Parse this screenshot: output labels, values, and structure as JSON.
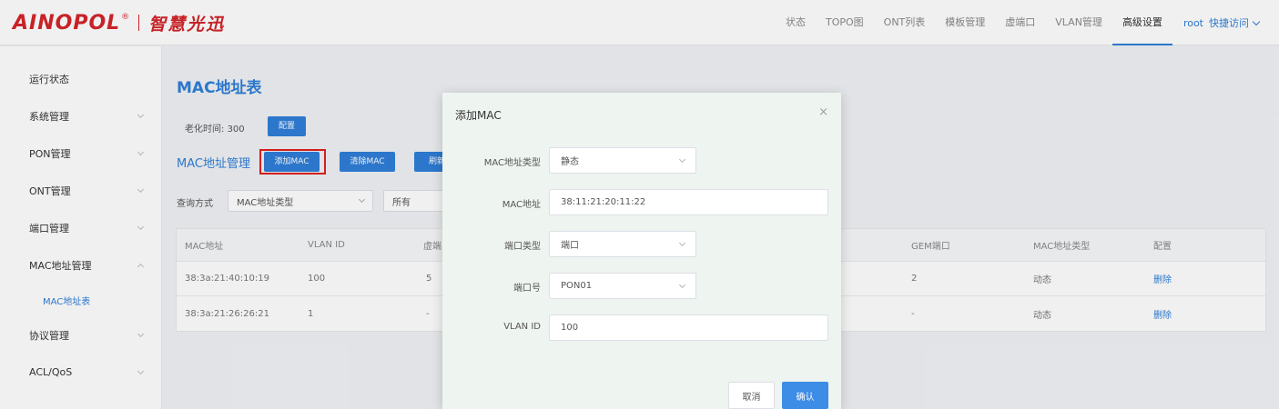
{
  "brand": {
    "name": "AINOPOL",
    "reg": "®",
    "cn": "智慧光迅"
  },
  "nav": {
    "items": [
      "状态",
      "TOPO图",
      "ONT列表",
      "模板管理",
      "虚端口",
      "VLAN管理",
      "高级设置"
    ],
    "active_index": 6,
    "user": "root",
    "quick": "快捷访问"
  },
  "sidebar": {
    "items": [
      {
        "label": "运行状态"
      },
      {
        "label": "系统管理"
      },
      {
        "label": "PON管理"
      },
      {
        "label": "ONT管理"
      },
      {
        "label": "端口管理"
      },
      {
        "label": "MAC地址管理",
        "expanded": true
      },
      {
        "label": "协议管理"
      },
      {
        "label": "ACL/QoS"
      }
    ],
    "sub_item": "MAC地址表"
  },
  "main": {
    "title": "MAC地址表",
    "aging_label": "老化时间:",
    "aging_value": "300",
    "config_button": "配置",
    "section_title": "MAC地址管理",
    "add_button": "添加MAC",
    "clear_button": "清除MAC",
    "refresh_button": "刷新",
    "query_label": "查询方式",
    "query_type": "MAC地址类型",
    "query_value": "所有"
  },
  "table": {
    "headers": [
      "MAC地址",
      "VLAN ID",
      "虚端",
      "GEM端口",
      "MAC地址类型",
      "配置"
    ],
    "rows": [
      [
        "38:3a:21:40:10:19",
        "100",
        "5",
        "2",
        "动态",
        "删除"
      ],
      [
        "38:3a:21:26:26:21",
        "1",
        "-",
        "-",
        "动态",
        "删除"
      ]
    ]
  },
  "modal": {
    "title": "添加MAC",
    "close": "×",
    "fields": {
      "mac_type_label": "MAC地址类型",
      "mac_type_value": "静态",
      "mac_addr_label": "MAC地址",
      "mac_addr_value": "38:11:21:20:11:22",
      "port_type_label": "端口类型",
      "port_type_value": "端口",
      "port_no_label": "端口号",
      "port_no_value": "PON01",
      "vlan_label": "VLAN ID",
      "vlan_value": "100"
    },
    "cancel": "取消",
    "ok": "确认"
  },
  "colors": {
    "accent": "#2f7fd8",
    "brand": "#d4252a",
    "highlight": "#e02020"
  }
}
